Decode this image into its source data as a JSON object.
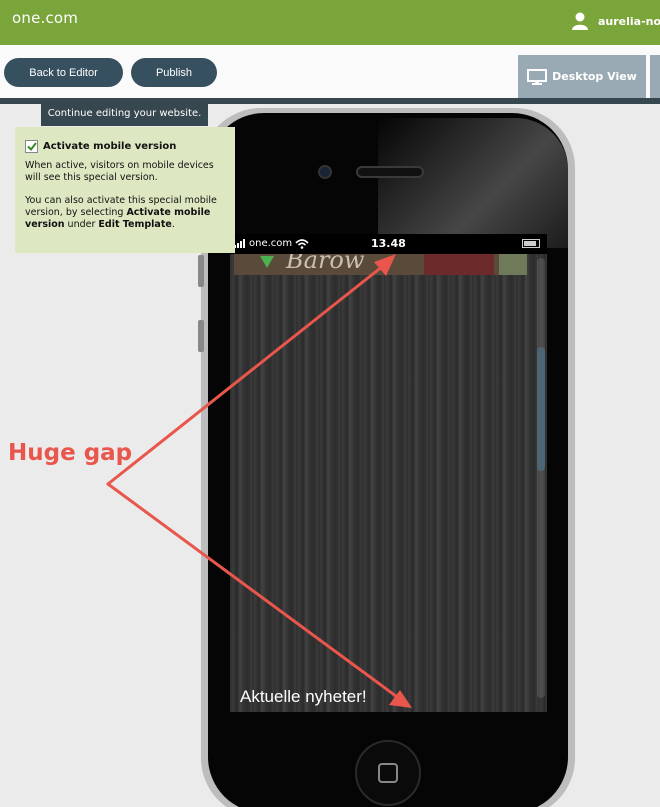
{
  "topbar": {
    "logo": "one.com",
    "user_name": "aurelia-nor",
    "user_icon": "user-icon"
  },
  "toolbar": {
    "back_label": "Back to Editor",
    "publish_label": "Publish",
    "desktop_view_label": "Desktop View",
    "desktop_icon": "monitor-icon"
  },
  "tooltip": {
    "text": "Continue editing your website."
  },
  "panel": {
    "checkbox_checked": true,
    "title": "Activate mobile version",
    "desc1": "When active, visitors on mobile devices will see this special version.",
    "desc2_a": "You can also activate this special mobile version, by selecting ",
    "desc2_b": "Activate mobile version",
    "desc2_c": " under ",
    "desc2_d": "Edit Template",
    "desc2_e": "."
  },
  "phone": {
    "carrier": "one.com",
    "time": "13.48",
    "banner_text": "Barow",
    "news_heading": "Aktuelle nyheter!"
  },
  "annotation": {
    "label": "Huge gap",
    "color": "#e8564c"
  },
  "colors": {
    "brand_green": "#7aa53a",
    "button": "#37505f",
    "panel_bg": "#dde8c2"
  }
}
